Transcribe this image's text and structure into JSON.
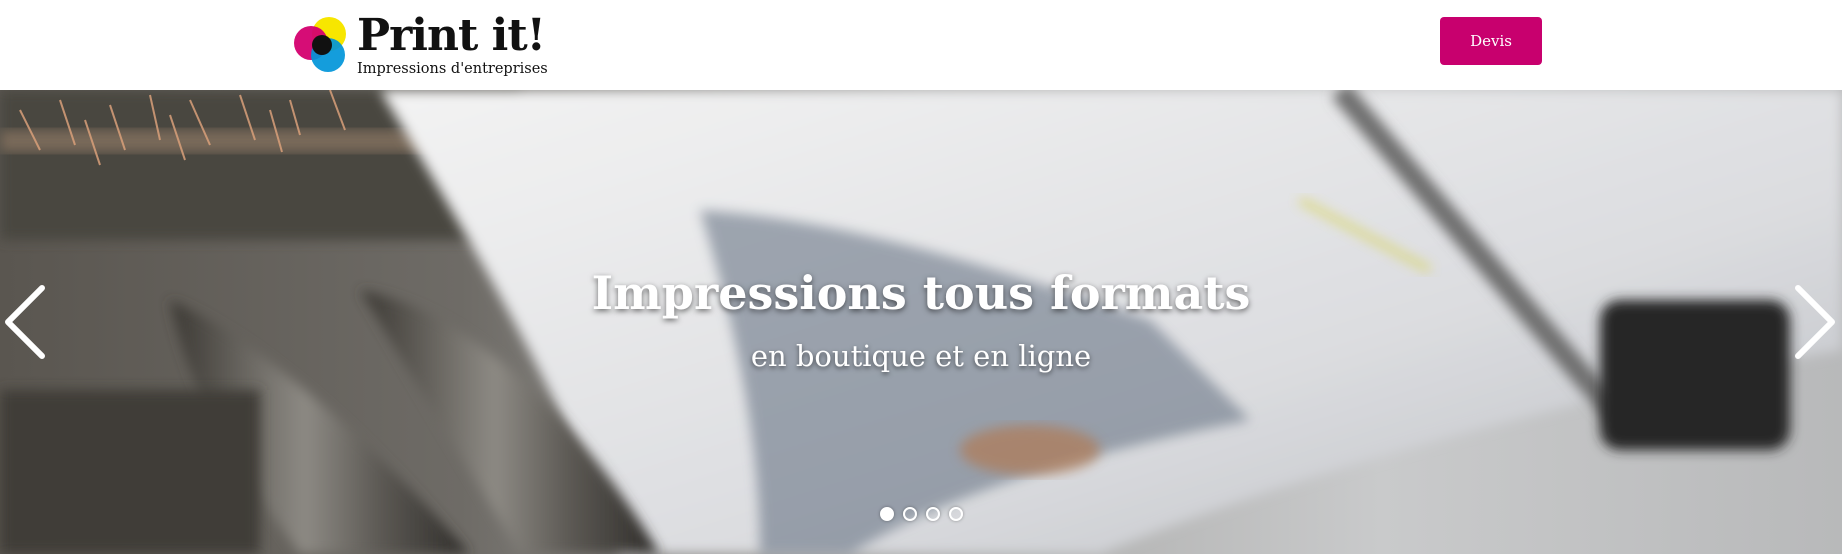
{
  "header": {
    "logo": {
      "title": "Print it!",
      "tagline": "Impressions d'entreprises",
      "colors": [
        "#f7e600",
        "#d4006f",
        "#0095d9",
        "#111111"
      ]
    },
    "devis_label": "Devis",
    "accent_color": "#c8006e"
  },
  "hero": {
    "title": "Impressions tous formats",
    "subtitle": "en boutique et en ligne",
    "prev_icon": "chevron-left-icon",
    "next_icon": "chevron-right-icon",
    "slides_count": 4,
    "active_slide": 1,
    "dots": [
      {
        "active": true
      },
      {
        "active": false
      },
      {
        "active": false
      },
      {
        "active": false
      }
    ]
  }
}
